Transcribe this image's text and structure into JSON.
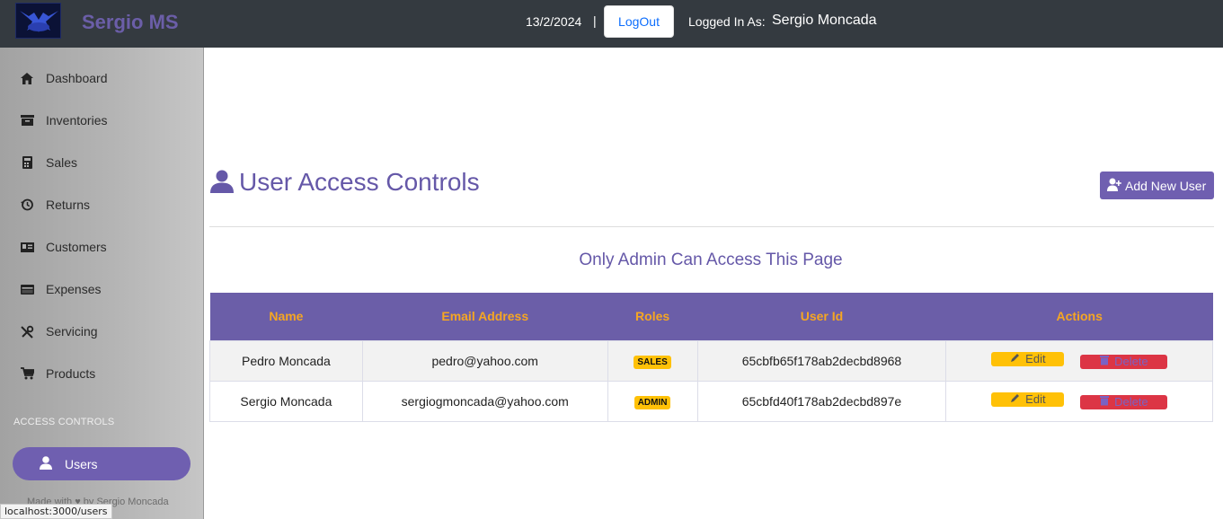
{
  "header": {
    "brand": "Sergio MS",
    "date": "13/2/2024",
    "separator": "|",
    "logout_label": "LogOut",
    "logged_in_label": "Logged In As:",
    "logged_in_user": "Sergio Moncada"
  },
  "sidebar": {
    "items": [
      {
        "label": "Dashboard",
        "icon": "home-icon"
      },
      {
        "label": "Inventories",
        "icon": "inbox-icon"
      },
      {
        "label": "Sales",
        "icon": "calculator-icon"
      },
      {
        "label": "Returns",
        "icon": "history-icon"
      },
      {
        "label": "Customers",
        "icon": "id-card-icon"
      },
      {
        "label": "Expenses",
        "icon": "credit-card-icon"
      },
      {
        "label": "Servicing",
        "icon": "tools-icon"
      },
      {
        "label": "Products",
        "icon": "cart-icon"
      }
    ],
    "section_title": "ACCESS CONTROLS",
    "users_label": "Users",
    "footer": "Made with ♥ by Sergio Moncada"
  },
  "status_bar": {
    "url": "localhost:3000/users"
  },
  "main": {
    "title": "User Access Controls",
    "add_button": "Add New User",
    "notice": "Only Admin Can Access This Page",
    "table": {
      "headers": [
        "Name",
        "Email Address",
        "Roles",
        "User Id",
        "Actions"
      ],
      "rows": [
        {
          "name": "Pedro Moncada",
          "email": "pedro@yahoo.com",
          "role": "SALES",
          "id": "65cbfb65f178ab2decbd8968"
        },
        {
          "name": "Sergio Moncada",
          "email": "sergiogmoncada@yahoo.com",
          "role": "ADMIN",
          "id": "65cbfd40f178ab2decbd897e"
        }
      ],
      "edit_label": "Edit",
      "delete_label": "Delete"
    }
  },
  "colors": {
    "topbar": "#343a40",
    "accent": "#6b5ea8",
    "header_text": "#f5a623",
    "edit": "#ffc107",
    "delete": "#dc3545"
  }
}
